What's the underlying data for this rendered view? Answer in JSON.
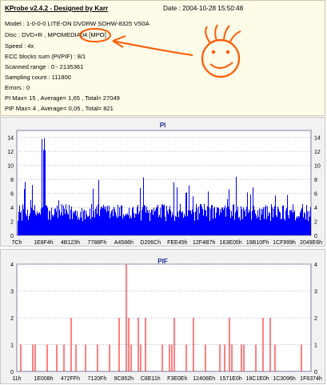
{
  "header": {
    "title": "KProbe v2.4.2 - Designed by Karr",
    "date": "Date : 2004-10-28 15:50:48"
  },
  "info_lines": [
    "Model : 1-0-0-0 LITE-ON DVDRW SOHW-8325  VS0A",
    "Disc : DVD+R , MPOMEDIA04",
    "Speed : 4x",
    "ECC blocks sum (PI/PIF) : 8/1",
    "Scanned range : 0 - 2135361",
    "Sampling count : 111800",
    "Errors : 0",
    "PI Max= 15 , Average= 1,65 , Total= 27049",
    "PIF Max= 4 , Average= 0,05 , Total= 821"
  ],
  "annotation": {
    "circled_text": "[MPO]",
    "color": "#ff5a00"
  },
  "chart_data": [
    {
      "type": "bar",
      "title": "PI",
      "color": "#0000ff",
      "ylim": [
        0,
        15
      ],
      "yticks": [
        0,
        2,
        4,
        6,
        8,
        10,
        12,
        14
      ],
      "xticks": [
        "7Ch",
        "1E8F4h",
        "4B123h",
        "7788Fh",
        "A4586h",
        "D206Ch",
        "FEE45h",
        "12F4B7h",
        "163E05h",
        "19B10Fh",
        "1CF999h",
        "2049E6h"
      ],
      "grid": true,
      "max": 15,
      "average": 1.65
    },
    {
      "type": "bar",
      "title": "PIF",
      "color": "#ff0000",
      "ylim": [
        0,
        4
      ],
      "yticks": [
        0,
        1,
        2,
        3,
        4
      ],
      "xticks": [
        "11h",
        "1E008h",
        "472FFh",
        "7120Fh",
        "9C852h",
        "C8E11h",
        "F3E0Eh",
        "12406Eh",
        "1571E0h",
        "18C1E0h",
        "1C3096h",
        "1F6374h"
      ],
      "grid": true,
      "max": 4,
      "average": 0.05
    }
  ]
}
